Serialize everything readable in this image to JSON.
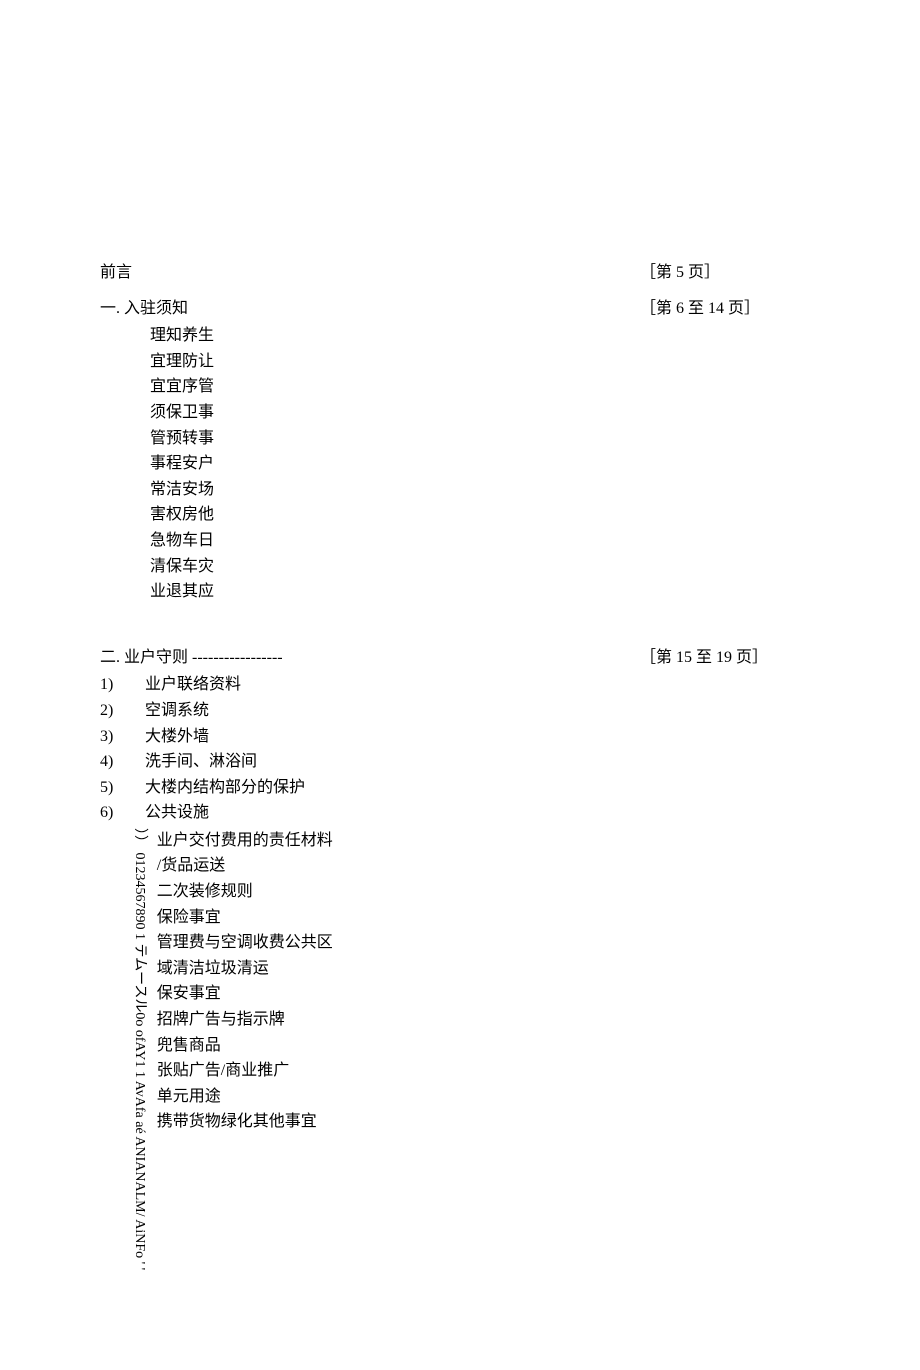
{
  "preface": {
    "label": "前言",
    "page": "［第 5 页］"
  },
  "section1": {
    "label": "一. 入驻须知",
    "page": "［第 6 至 14 页］",
    "col1": "理\n宜\n宜\n须\n管\n事\n常\n害\n急\n清\n业",
    "col2": "知\n理\n宜\n保\n预\n程\n洁\n权\n物\n保\n退",
    "col3": "养\n防\n序\n卫\n转\n安\n安\n房\n车\n车\n其",
    "col4": "生\n让\n管\n事\n事\n户\n场\n他\n日\n灾\n应"
  },
  "section2": {
    "label": "二. 业户守则",
    "dashes": " -----------------",
    "page": "［第 15 至 19 页］",
    "items": [
      {
        "num": "1)",
        "text": "业户联络资料"
      },
      {
        "num": "2)",
        "text": "空调系统"
      },
      {
        "num": "3)",
        "text": "大楼外墙"
      },
      {
        "num": "4)",
        "text": "洗手间、淋浴间"
      },
      {
        "num": "5)",
        "text": "大楼内结构部分的保护"
      },
      {
        "num": "6)",
        "text": "公共设施"
      }
    ],
    "rotated": "）） 01234567890 1 テムースル0o ofAY1 1 AvAfa aé ANIANALM/ AiNFo ' '",
    "sublines": [
      "业户交付费用的责任材料",
      "/货品运送",
      "二次装修规则",
      "保险事宜",
      "管理费与空调收费公共区",
      "域清洁垃圾清运",
      "保安事宜",
      "招牌广告与指示牌",
      "兜售商品",
      "张贴广告/商业推广",
      "单元用途",
      "携带货物绿化其他事宜"
    ]
  }
}
